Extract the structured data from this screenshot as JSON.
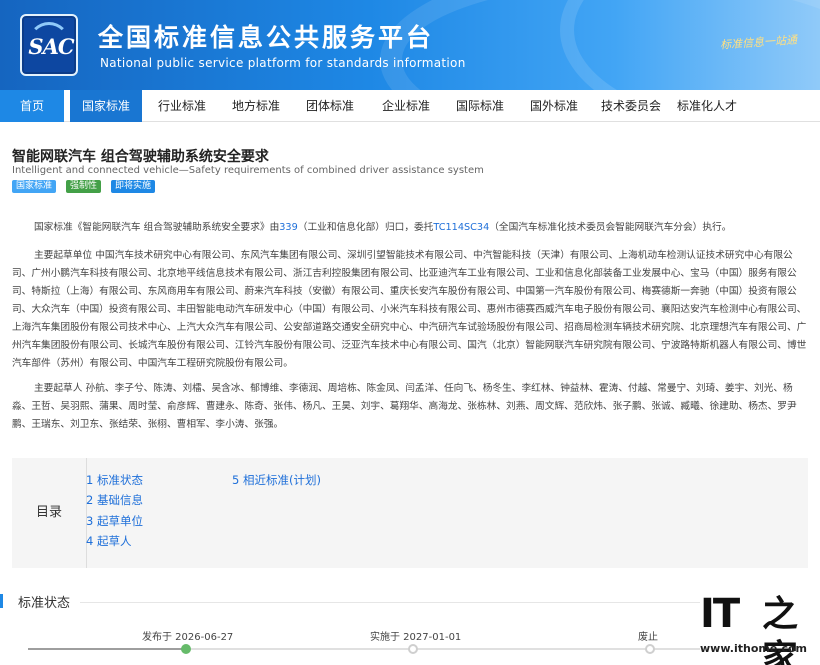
{
  "header": {
    "logo_text": "SAC",
    "title": "全国标准信息公共服务平台",
    "subtitle": "National public service platform  for standards information",
    "slogan": "标准信息一站通"
  },
  "nav": {
    "items": [
      {
        "label": "首页"
      },
      {
        "label": "国家标准"
      },
      {
        "label": "行业标准"
      },
      {
        "label": "地方标准"
      },
      {
        "label": "团体标准"
      },
      {
        "label": "企业标准"
      },
      {
        "label": "国际标准"
      },
      {
        "label": "国外标准"
      },
      {
        "label": "技术委员会"
      },
      {
        "label": "标准化人才"
      }
    ]
  },
  "doc": {
    "title": "智能网联汽车 组合驾驶辅助系统安全要求",
    "title_en": "Intelligent and connected vehicle—Safety requirements of combined driver assistance system",
    "tags": [
      "国家标准",
      "强制性",
      "即将实施"
    ],
    "intro": {
      "part1": "国家标准《智能网联汽车 组合驾驶辅助系统安全要求》由",
      "link1": "339",
      "part2": "（工业和信息化部）归口，委托",
      "link2": "TC114SC34",
      "part3": "（全国汽车标准化技术委员会智能网联汽车分会）执行。"
    },
    "drafting_units": "主要起草单位 中国汽车技术研究中心有限公司、东风汽车集团有限公司、深圳引望智能技术有限公司、中汽智能科技（天津）有限公司、上海机动车检测认证技术研究中心有限公司、广州小鹏汽车科技有限公司、北京地平线信息技术有限公司、浙江吉利控股集团有限公司、比亚迪汽车工业有限公司、工业和信息化部装备工业发展中心、宝马（中国）服务有限公司、特斯拉（上海）有限公司、东风商用车有限公司、蔚来汽车科技（安徽）有限公司、重庆长安汽车股份有限公司、中国第一汽车股份有限公司、梅赛德斯一奔驰（中国）投资有限公司、大众汽车（中国）投资有限公司、丰田智能电动汽车研发中心（中国）有限公司、小米汽车科技有限公司、惠州市德赛西威汽车电子股份有限公司、襄阳达安汽车检测中心有限公司、上海汽车集团股份有限公司技术中心、上汽大众汽车有限公司、公安部道路交通安全研究中心、中汽研汽车试验场股份有限公司、招商局检测车辆技术研究院、北京理想汽车有限公司、广州汽车集团股份有限公司、长城汽车股份有限公司、江铃汽车股份有限公司、泛亚汽车技术中心有限公司、国汽（北京）智能网联汽车研究院有限公司、宁波路特斯机器人有限公司、博世汽车部件（苏州）有限公司、中国汽车工程研究院股份有限公司。",
    "drafters": "主要起草人 孙航、李子兮、陈涛、刘檑、吴含冰、郁博维、李德润、周培栋、陈金凤、闫孟洋、任向飞、杨冬生、李红林、钟益林、霍涛、付越、常曼宁、刘琦、姜宇、刘光、杨淼、王哲、吴羽熙、蒲果、周时莹、俞彦辉、曹建永、陈奇、张伟、杨凡、王昊、刘宇、葛翔华、高海龙、张栋林、刘燕、周文辉、范欣炜、张子鹏、张诚、臧曦、徐建助、杨杰、罗尹鹏、王瑞东、刘卫东、张结荣、张栩、曹相军、李小涛、张强。"
  },
  "toc": {
    "label": "目录",
    "items": [
      {
        "label": "1 标准状态"
      },
      {
        "label": "2 基础信息"
      },
      {
        "label": "3 起草单位"
      },
      {
        "label": "4 起草人"
      },
      {
        "label": "5 相近标准(计划)"
      }
    ]
  },
  "status": {
    "section_title": "标准状态",
    "published": "发布于 2026-06-27",
    "effective": "实施于 2027-01-01",
    "abolished": "废止"
  },
  "watermark": {
    "logo": "IT",
    "logo_char": "之家",
    "url": "www.ithome.com"
  }
}
